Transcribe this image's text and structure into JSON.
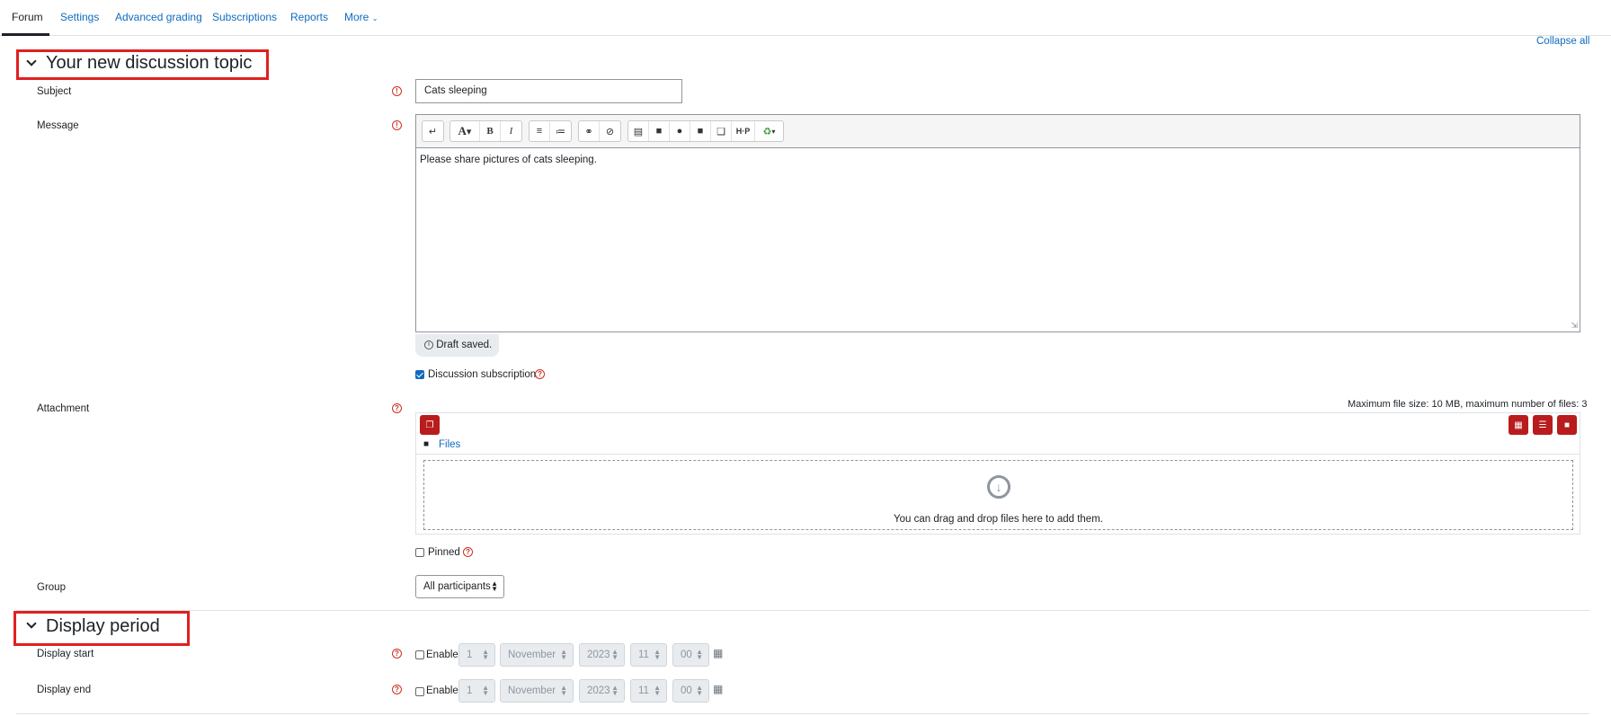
{
  "nav": {
    "tabs": [
      {
        "label": "Forum",
        "active": true
      },
      {
        "label": "Settings"
      },
      {
        "label": "Advanced grading"
      },
      {
        "label": "Subscriptions"
      },
      {
        "label": "Reports"
      },
      {
        "label": "More"
      }
    ],
    "collapse_all": "Collapse all"
  },
  "section1": {
    "title": "Your new discussion topic",
    "subject_label": "Subject",
    "subject_value": "Cats sleeping",
    "message_label": "Message",
    "message_text": "Please share pictures of cats sleeping.",
    "draft_status": "Draft saved.",
    "subscription_label": "Discussion subscription",
    "subscription_checked": true,
    "attachment_label": "Attachment",
    "attachment_limits": "Maximum file size: 10 MB, maximum number of files: 3",
    "files_label": "Files",
    "dropzone_text": "You can drag and drop files here to add them.",
    "pinned_label": "Pinned",
    "group_label": "Group",
    "group_value": "All participants"
  },
  "section2": {
    "title": "Display period",
    "display_start_label": "Display start",
    "display_end_label": "Display end",
    "enable_label": "Enable",
    "day": "1",
    "month": "November",
    "year": "2023",
    "hour": "11",
    "minute": "00"
  },
  "colors": {
    "link": "#0f6cbf",
    "highlight_box": "#e02020",
    "required_icon": "#ca3120",
    "file_button": "#b81c1c"
  },
  "toolbar_icons": [
    "collapse-icon",
    "text-style-icon",
    "bold-icon",
    "italic-icon",
    "unordered-list-icon",
    "ordered-list-icon",
    "link-icon",
    "unlink-icon",
    "image-icon",
    "media-icon",
    "record-audio-icon",
    "record-video-icon",
    "manage-files-icon",
    "h5p-icon",
    "recycle-icon"
  ]
}
